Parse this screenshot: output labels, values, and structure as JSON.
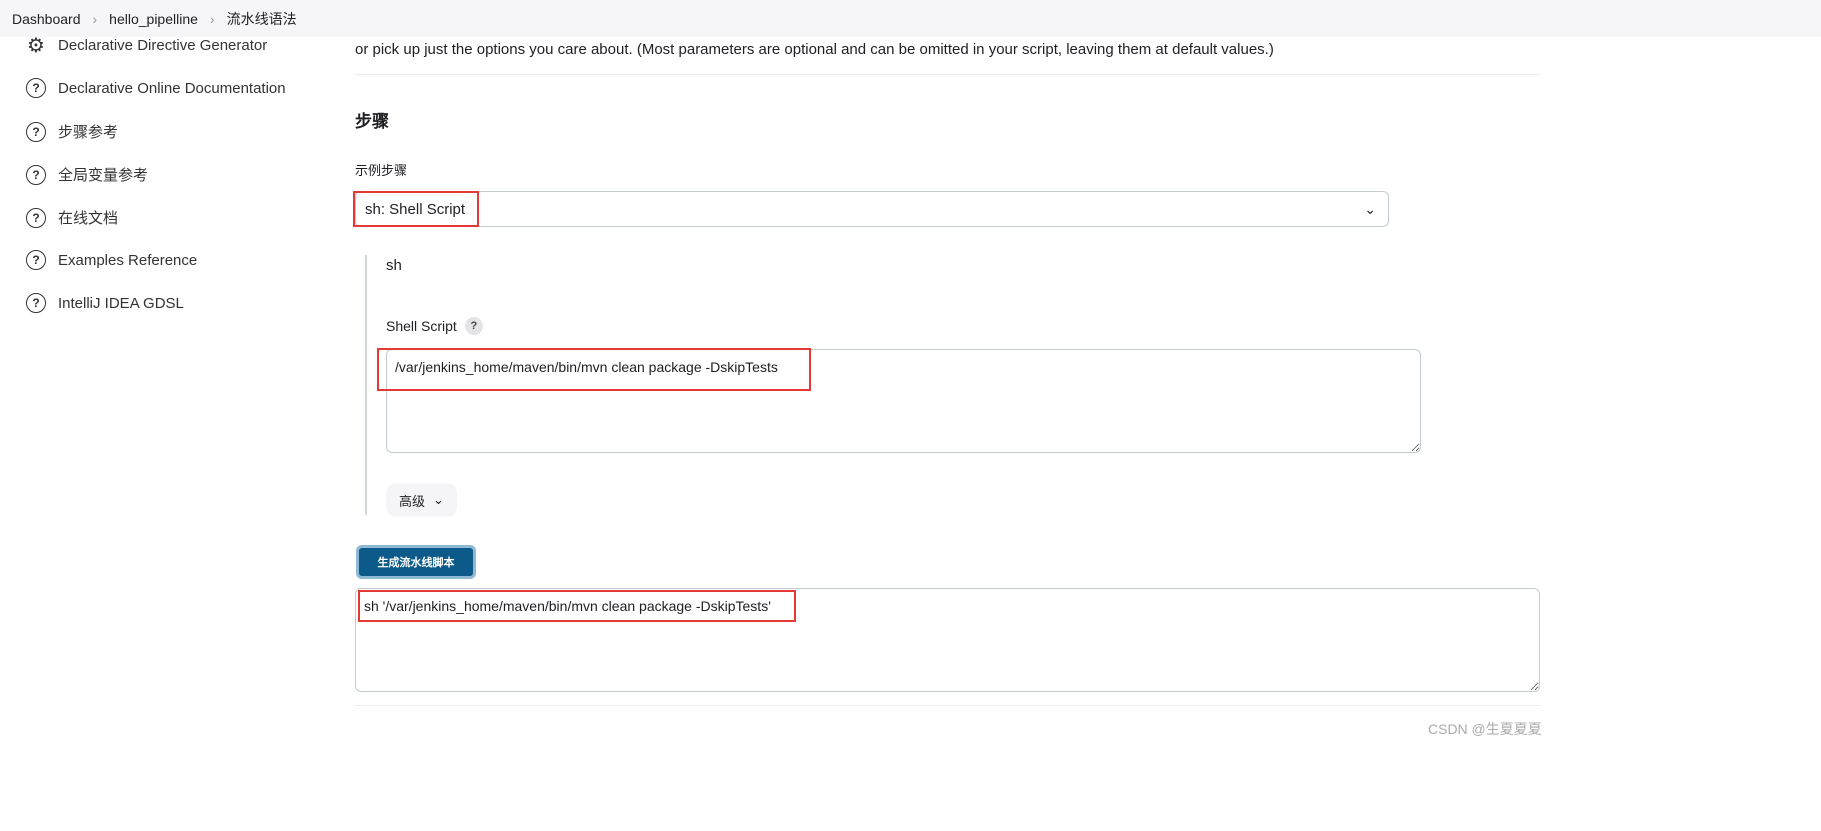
{
  "breadcrumb": [
    "Dashboard",
    "hello_pipelline",
    "流水线语法"
  ],
  "sidebar": {
    "items": [
      {
        "label": "Declarative Directive Generator",
        "icon": "gear-icon"
      },
      {
        "label": "Declarative Online Documentation",
        "icon": "help-icon"
      },
      {
        "label": "步骤参考",
        "icon": "help-icon"
      },
      {
        "label": "全局变量参考",
        "icon": "help-icon"
      },
      {
        "label": "在线文档",
        "icon": "help-icon"
      },
      {
        "label": "Examples Reference",
        "icon": "help-icon"
      },
      {
        "label": "IntelliJ IDEA GDSL",
        "icon": "help-icon"
      }
    ]
  },
  "main": {
    "description": "or pick up just the options you care about. (Most parameters are optional and can be omitted in your script, leaving them at default values.)",
    "section_title": "步骤",
    "sample_step_label": "示例步骤",
    "sample_step_value": "sh: Shell Script",
    "step_name": "sh",
    "shell_script_label": "Shell Script",
    "help_label": "?",
    "shell_script_value": "/var/jenkins_home/maven/bin/mvn clean package -DskipTests",
    "advanced_label": "高级",
    "generate_label": "生成流水线脚本",
    "output_value": "sh '/var/jenkins_home/maven/bin/mvn clean package -DskipTests'"
  },
  "watermark": "CSDN @生夏夏夏",
  "colors": {
    "primary_button": "#0b5a8a",
    "highlight": "#e53935"
  }
}
